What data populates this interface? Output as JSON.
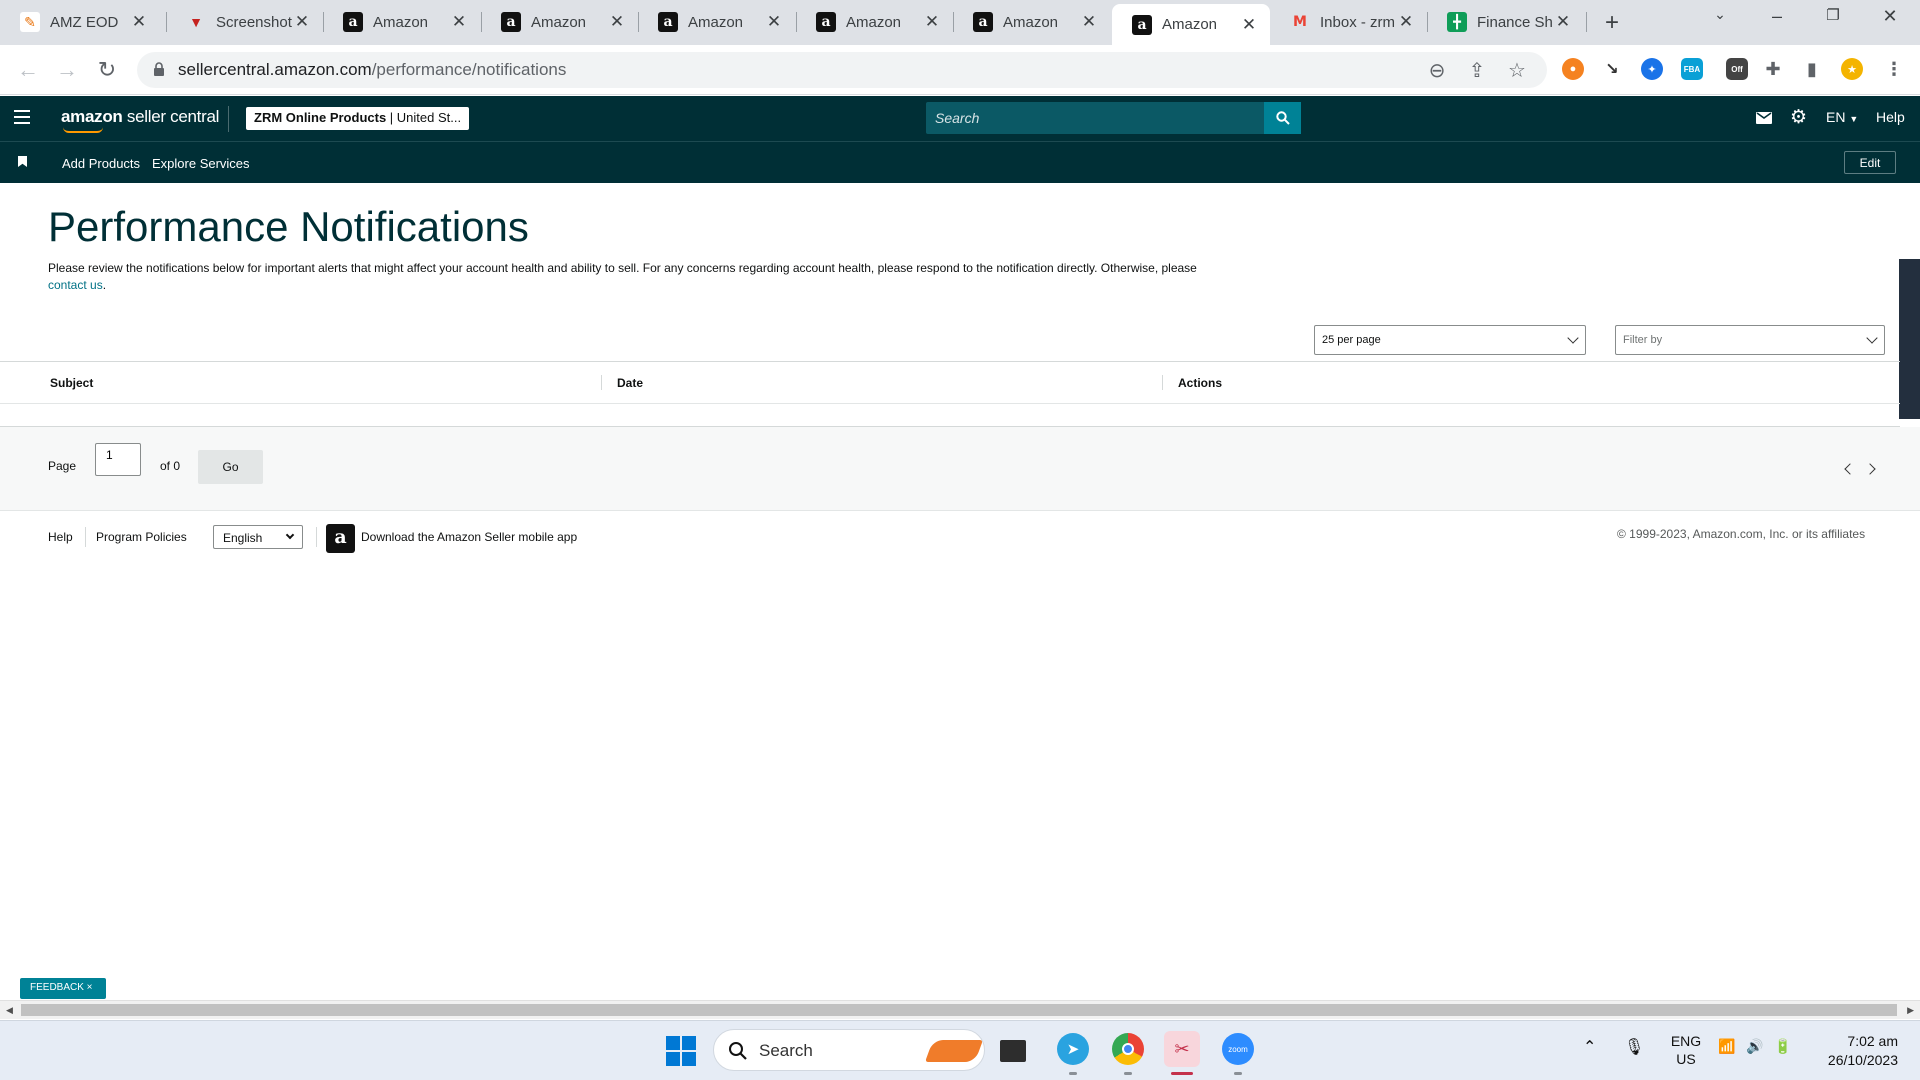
{
  "browser": {
    "tabs": [
      {
        "title": "AMZ EOD",
        "icon": "amz-eod-favicon"
      },
      {
        "title": "Screenshot",
        "icon": "screenshot-favicon"
      },
      {
        "title": "Amazon",
        "icon": "amazon-favicon"
      },
      {
        "title": "Amazon",
        "icon": "amazon-favicon"
      },
      {
        "title": "Amazon",
        "icon": "amazon-favicon"
      },
      {
        "title": "Amazon",
        "icon": "amazon-favicon"
      },
      {
        "title": "Amazon",
        "icon": "amazon-favicon"
      },
      {
        "title": "Amazon",
        "icon": "amazon-favicon",
        "active": true
      },
      {
        "title": "Inbox - zrm",
        "icon": "gmail-favicon"
      },
      {
        "title": "Finance Sh",
        "icon": "sheets-favicon"
      }
    ],
    "url_host": "sellercentral.amazon.com",
    "url_path": "/performance/notifications"
  },
  "header": {
    "logo_bold": "amazon",
    "logo_rest": " seller central",
    "account_name": "ZRM Online Products",
    "account_region": "United St...",
    "search_placeholder": "Search",
    "language": "EN",
    "help": "Help"
  },
  "subnav": {
    "items": [
      "Add Products",
      "Explore Services"
    ],
    "edit": "Edit"
  },
  "main": {
    "title": "Performance Notifications",
    "description": "Please review the notifications below for important alerts that might affect your account health and ability to sell. For any concerns regarding account health, please respond to the notification directly. Otherwise, please",
    "contact_link": "contact us",
    "per_page": "25 per page",
    "filter_placeholder": "Filter by",
    "columns": [
      "Subject",
      "Date",
      "Actions"
    ]
  },
  "pager": {
    "page_label": "Page",
    "page_value": "1",
    "of_label": "of 0",
    "go": "Go"
  },
  "footer": {
    "help": "Help",
    "program_policies": "Program Policies",
    "language": "English",
    "app_text": "Download the Amazon Seller mobile app",
    "copyright": "© 1999-2023, Amazon.com, Inc. or its affiliates"
  },
  "feedback": "FEEDBACK ×",
  "taskbar": {
    "search_label": "Search",
    "lang_top": "ENG",
    "lang_bottom": "US",
    "time": "7:02 am",
    "date": "26/10/2023"
  },
  "colors": {
    "header_bg": "#002f36",
    "search_bg": "#0b5965",
    "accent": "#008296",
    "link": "#007185"
  }
}
